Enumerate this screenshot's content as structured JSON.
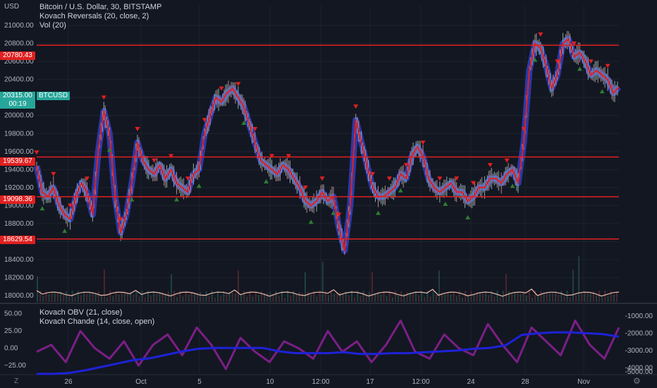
{
  "legend": {
    "main": "Bitcoin / U.S. Dollar, 30, BITSTAMP",
    "ind1": "Kovach Reversals (20, close, 2)",
    "ind2": "Vol (20)",
    "sub1": "Kovach OBV (21, close)",
    "sub2": "Kovach Chande (14, close, open)"
  },
  "currency": "USD",
  "price_axis": {
    "ticks": [
      "21000.00",
      "20800.00",
      "20600.00",
      "20400.00",
      "20200.00",
      "20000.00",
      "19800.00",
      "19600.00",
      "19400.00",
      "19200.00",
      "19000.00",
      "18800.00",
      "18600.00",
      "18400.00",
      "18200.00",
      "18000.00"
    ],
    "levels": [
      {
        "label": "20780.43",
        "color": "#e02020"
      },
      {
        "label": "19539.67",
        "color": "#e02020"
      },
      {
        "label": "19098.36",
        "color": "#e02020"
      },
      {
        "label": "18629.54",
        "color": "#e02020"
      }
    ],
    "last_price": {
      "label": "20315.00",
      "sub": "00:19",
      "symbol": "BTCUSD",
      "color": "#26a69a"
    }
  },
  "time_axis": [
    "26",
    "Oct",
    "5",
    "10",
    "12:00",
    "17",
    "12:00",
    "24",
    "28",
    "Nov"
  ],
  "sub_axis_left": [
    "50.00",
    "25.00",
    "0.00",
    "−25.00"
  ],
  "sub_axis_right": [
    "-1000.00",
    "-2000.00",
    "-3000.00",
    "-4000.00",
    "-5000.00"
  ],
  "corner_label": "Z",
  "settings_icon": "gear-icon",
  "colors": {
    "bg": "#131722",
    "red": "#e02020",
    "green": "#2e7d32",
    "blue": "#2f3fbf",
    "obv": "#1e22d8",
    "chande": "#7b1f86",
    "vol": "#e8b9a8",
    "teal": "#26a69a"
  },
  "chart_data": {
    "type": "line",
    "title": "Bitcoin / U.S. Dollar, 30, BITSTAMP",
    "ylabel": "USD",
    "ylim": [
      17930,
      21220
    ],
    "x_ticks": [
      "26",
      "Oct",
      "5",
      "10",
      "12:00",
      "17",
      "12:00",
      "24",
      "28",
      "Nov"
    ],
    "horizontal_levels": [
      20780.43,
      19539.67,
      19098.36,
      18629.54
    ],
    "last_price": 20315.0,
    "series": [
      {
        "name": "BTCUSD",
        "values": [
          19440,
          19150,
          19100,
          19200,
          19000,
          18900,
          18850,
          19100,
          19250,
          19150,
          18900,
          19600,
          20050,
          19800,
          19100,
          18700,
          18900,
          19250,
          19700,
          19500,
          19400,
          19350,
          19450,
          19300,
          19400,
          19250,
          19200,
          19150,
          19350,
          19400,
          19800,
          20000,
          20200,
          20150,
          20250,
          20300,
          20200,
          20100,
          19900,
          19700,
          19500,
          19450,
          19400,
          19350,
          19450,
          19400,
          19300,
          19200,
          19050,
          19000,
          19050,
          19150,
          19050,
          19100,
          18750,
          18500,
          19000,
          19950,
          19700,
          19450,
          19200,
          19100,
          19100,
          19150,
          19200,
          19350,
          19300,
          19550,
          19650,
          19550,
          19300,
          19200,
          19150,
          19200,
          19250,
          19150,
          19150,
          19050,
          19100,
          19200,
          19200,
          19300,
          19300,
          19250,
          19350,
          19400,
          19250,
          19700,
          20500,
          20800,
          20750,
          20550,
          20300,
          20450,
          20800,
          20850,
          20650,
          20700,
          20600,
          20450,
          20500,
          20450,
          20400,
          20250,
          20315
        ]
      }
    ],
    "volume_label": "Vol (20)",
    "sub_series": [
      {
        "name": "Kovach OBV (21, close)",
        "range": [
          -5000,
          -1000
        ],
        "values": [
          -4100,
          -4100,
          -4050,
          -3900,
          -3700,
          -3500,
          -3300,
          -3200,
          -3000,
          -2800,
          -2650,
          -2600,
          -2600,
          -2600,
          -2600,
          -2800,
          -2900,
          -2900,
          -2900,
          -2850,
          -2950,
          -2950,
          -2900,
          -2900,
          -2850,
          -2800,
          -2750,
          -2650,
          -2600,
          -2450,
          -1850,
          -1750,
          -1700,
          -1700,
          -1750,
          -1800,
          -1950
        ]
      },
      {
        "name": "Kovach Chande (14, close, open)",
        "range": [
          -37,
          63
        ],
        "values": [
          -5,
          5,
          -20,
          25,
          0,
          -15,
          10,
          -25,
          5,
          20,
          -10,
          30,
          5,
          -30,
          15,
          -5,
          -20,
          10,
          0,
          -15,
          25,
          -5,
          10,
          -20,
          5,
          40,
          -5,
          -15,
          20,
          0,
          -10,
          35,
          5,
          -20,
          30,
          10,
          -10,
          40,
          5,
          -15,
          30
        ]
      }
    ]
  }
}
